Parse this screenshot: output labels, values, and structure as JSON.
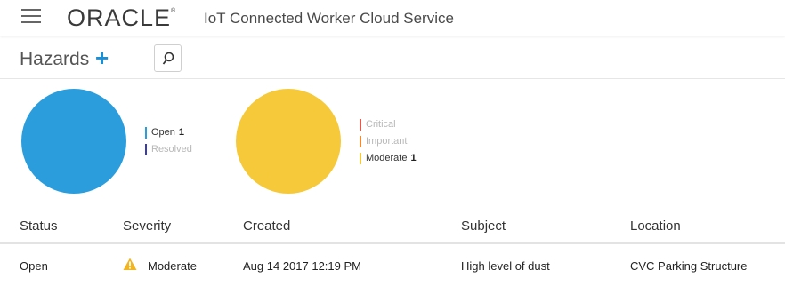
{
  "header": {
    "logo_text": "ORACLE",
    "logo_mark": "®",
    "app_title": "IoT Connected Worker Cloud Service",
    "menu_icon": "hamburger-menu-icon"
  },
  "toolbar": {
    "page_title": "Hazards",
    "add_icon": "plus-icon",
    "search_icon": "search-icon"
  },
  "charts": {
    "status": {
      "legend": [
        {
          "label": "Open",
          "count": "1",
          "color": "#2b9ddc"
        },
        {
          "label": "Resolved",
          "count": "",
          "color": "#3b3bb0"
        }
      ]
    },
    "severity": {
      "legend": [
        {
          "label": "Critical",
          "count": "",
          "color": "#e05a4c"
        },
        {
          "label": "Important",
          "count": "",
          "color": "#f08a30"
        },
        {
          "label": "Moderate",
          "count": "1",
          "color": "#f6c93a"
        }
      ]
    }
  },
  "chart_data": [
    {
      "type": "pie",
      "categories": [
        "Open",
        "Resolved"
      ],
      "values": [
        1,
        0
      ],
      "colors": [
        "#2b9ddc",
        "#3b3bb0"
      ],
      "legend_placement": "right"
    },
    {
      "type": "pie",
      "categories": [
        "Critical",
        "Important",
        "Moderate"
      ],
      "values": [
        0,
        0,
        1
      ],
      "colors": [
        "#e05a4c",
        "#f08a30",
        "#f6c93a"
      ],
      "legend_placement": "right"
    }
  ],
  "table": {
    "columns": [
      "Status",
      "Severity",
      "Created",
      "Subject",
      "Location"
    ],
    "rows": [
      {
        "status": "Open",
        "severity": "Moderate",
        "severity_icon": "warning-icon",
        "created": "Aug 14 2017 12:19 PM",
        "subject": "High level of dust",
        "location": "CVC Parking Structure"
      }
    ]
  }
}
